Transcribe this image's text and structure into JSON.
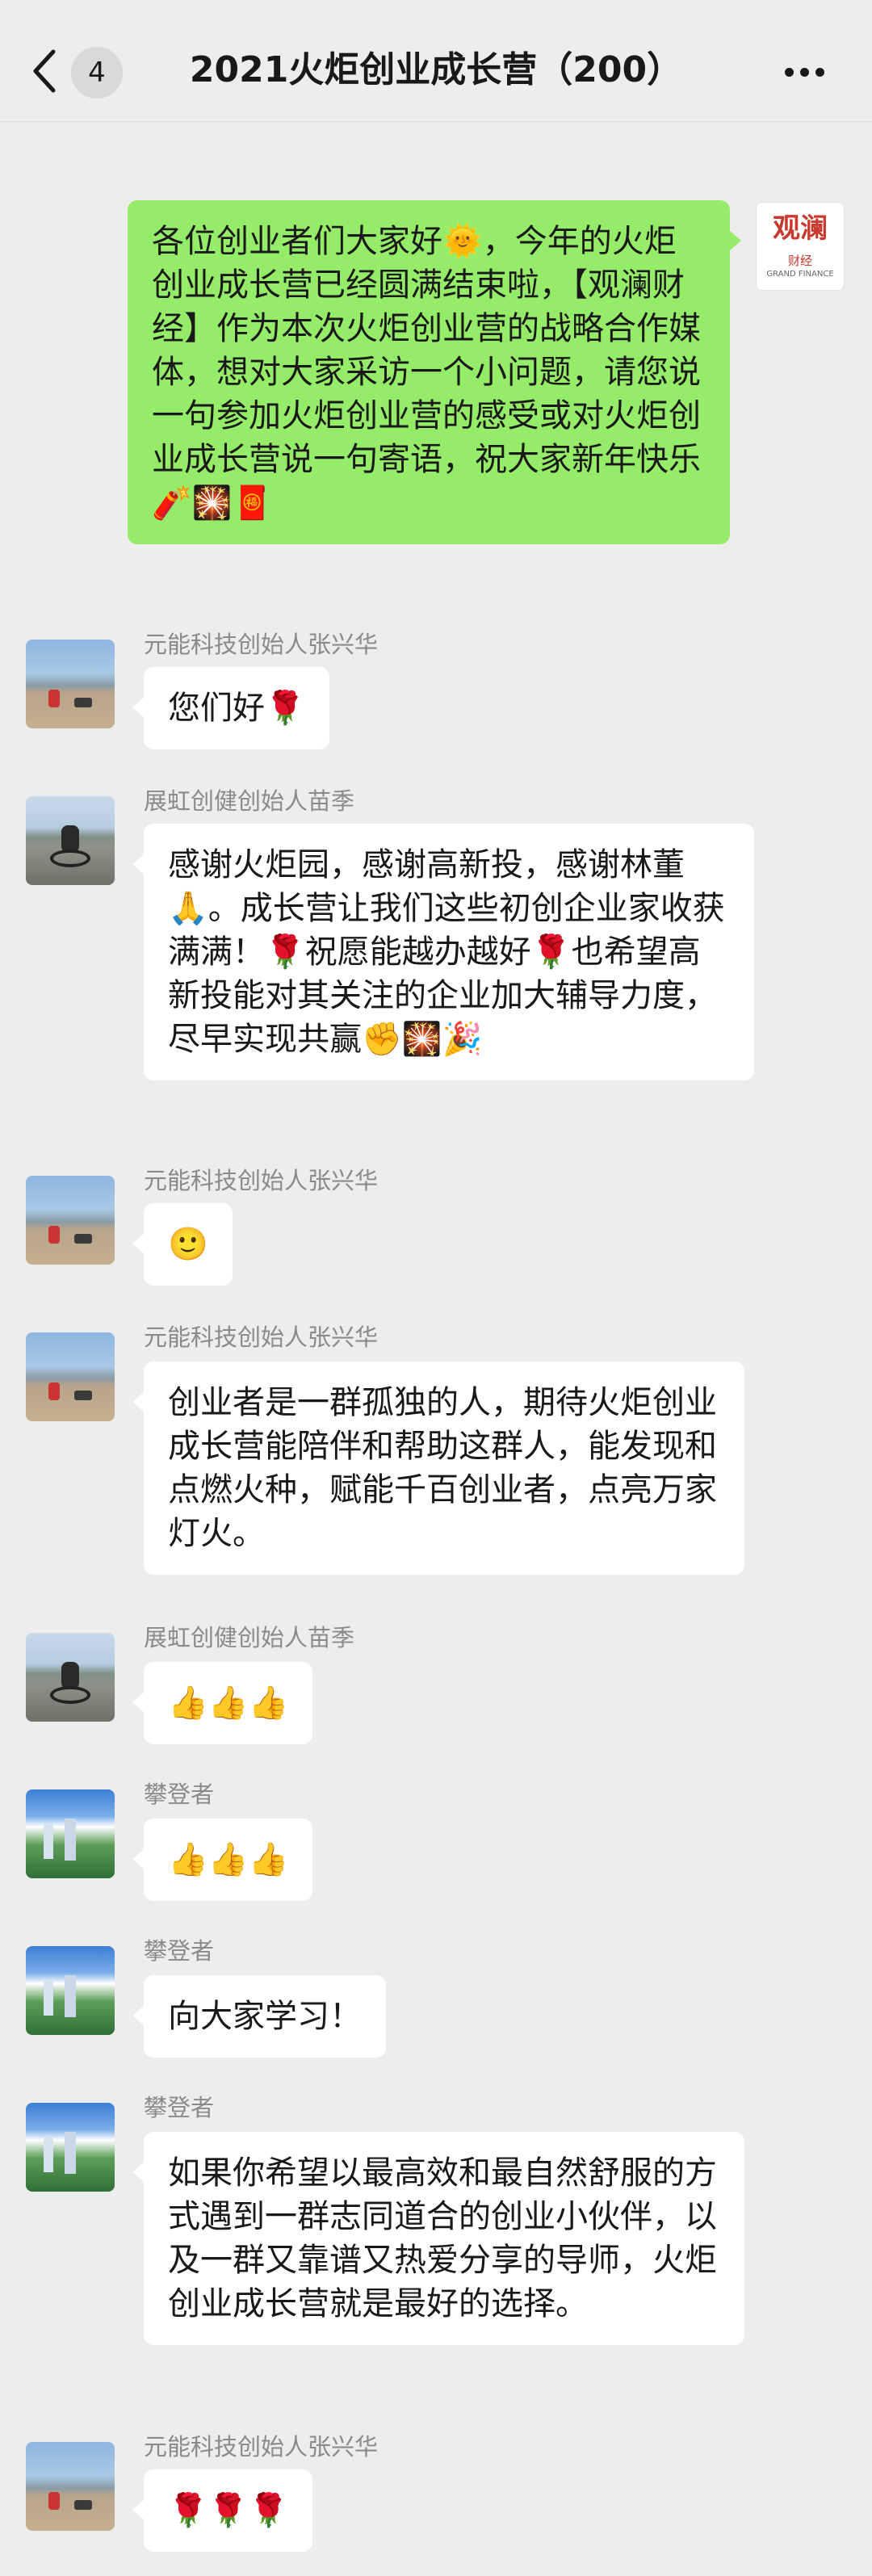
{
  "header": {
    "back_icon": "chevron-left-icon",
    "unread_count": "4",
    "title": "2021火炬创业成长营（200）",
    "more_icon": "more-dots-icon"
  },
  "messages": [
    {
      "side": "right",
      "avatar": "观澜财经 logo",
      "avatar_text": {
        "main": "观澜",
        "sub": "财经",
        "sub2": "GRAND FINANCE"
      },
      "text": "各位创业者们大家好🌞，今年的火炬创业成长营已经圆满结束啦，【观澜财经】作为本次火炬创业营的战略合作媒体，想对大家采访一个小问题，请您说一句参加火炬创业营的感受或对火炬创业成长营说一句寄语，祝大家新年快乐🧨🎇🧧"
    },
    {
      "side": "left",
      "sender": "元能科技创始人张兴华",
      "text": "您们好🌹"
    },
    {
      "side": "left",
      "sender": "展虹创健创始人苗季",
      "text": "感谢火炬园，感谢高新投，感谢林董🙏。成长营让我们这些初创企业家收获满满！🌹祝愿能越办越好🌹也希望高新投能对其关注的企业加大辅导力度，尽早实现共赢✊🎇🎉"
    },
    {
      "side": "left",
      "sender": "元能科技创始人张兴华",
      "text": "🙂"
    },
    {
      "side": "left",
      "sender": "元能科技创始人张兴华",
      "text": "创业者是一群孤独的人，期待火炬创业成长营能陪伴和帮助这群人，能发现和点燃火种，赋能千百创业者，点亮万家灯火。"
    },
    {
      "side": "left",
      "sender": "展虹创健创始人苗季",
      "text": "👍👍👍"
    },
    {
      "side": "left",
      "sender": "攀登者",
      "text": "👍👍👍"
    },
    {
      "side": "left",
      "sender": "攀登者",
      "text": "向大家学习！"
    },
    {
      "side": "left",
      "sender": "攀登者",
      "text": "如果你希望以最高效和最自然舒服的方式遇到一群志同道合的创业小伙伴，以及一群又靠谱又热爱分享的导师，火炬创业成长营就是最好的选择。"
    },
    {
      "side": "left",
      "sender": "元能科技创始人张兴华",
      "text": "🌹🌹🌹"
    }
  ]
}
